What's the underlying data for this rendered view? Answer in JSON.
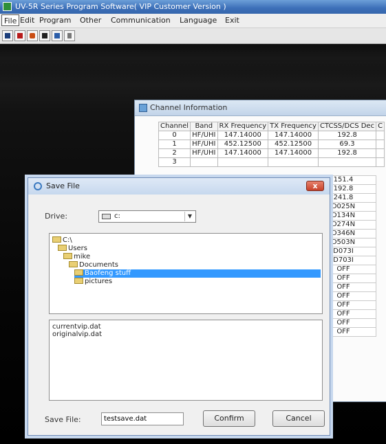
{
  "app": {
    "title": "UV-5R Series Program Software( VIP Customer Version )"
  },
  "menu": {
    "items": [
      "File",
      "Edit",
      "Program",
      "Other",
      "Communication",
      "Language",
      "Exit"
    ]
  },
  "toolbar": {
    "icons": [
      "open-icon",
      "save-icon",
      "read-icon",
      "write-icon",
      "program-icon",
      "help-icon"
    ]
  },
  "channel_window": {
    "title": "Channel Information",
    "columns": [
      "Channel",
      "Band",
      "RX Frequency",
      "TX Frequency",
      "CTCSS/DCS Dec",
      "C"
    ],
    "rows": [
      [
        "0",
        "HF/UHI",
        "147.14000",
        "147.14000",
        "192.8",
        ""
      ],
      [
        "1",
        "HF/UHI",
        "452.12500",
        "452.12500",
        "69.3",
        ""
      ],
      [
        "2",
        "HF/UHI",
        "147.14000",
        "147.14000",
        "192.8",
        ""
      ],
      [
        "3",
        "",
        "",
        "",
        "",
        ""
      ]
    ],
    "dec_values": [
      "151.4",
      "192.8",
      "241.8",
      "D025N",
      "D134N",
      "D274N",
      "D346N",
      "D503N",
      "D073I",
      "D703I",
      "OFF",
      "OFF",
      "OFF",
      "OFF",
      "OFF",
      "OFF",
      "OFF",
      "OFF"
    ]
  },
  "save_dialog": {
    "title": "Save File",
    "close_label": "x",
    "drive_label": "Drive:",
    "drive_value": "c:",
    "tree": [
      {
        "label": "C:\\",
        "indent": 0,
        "selected": false
      },
      {
        "label": "Users",
        "indent": 1,
        "selected": false
      },
      {
        "label": "mike",
        "indent": 2,
        "selected": false
      },
      {
        "label": "Documents",
        "indent": 3,
        "selected": false
      },
      {
        "label": "Baofeng stuff",
        "indent": 4,
        "selected": true
      },
      {
        "label": "pictures",
        "indent": 4,
        "selected": false
      }
    ],
    "files": [
      "currentvip.dat",
      "originalvip.dat"
    ],
    "save_file_label": "Save File:",
    "save_file_value": "testsave.dat",
    "confirm_label": "Confirm",
    "cancel_label": "Cancel"
  }
}
